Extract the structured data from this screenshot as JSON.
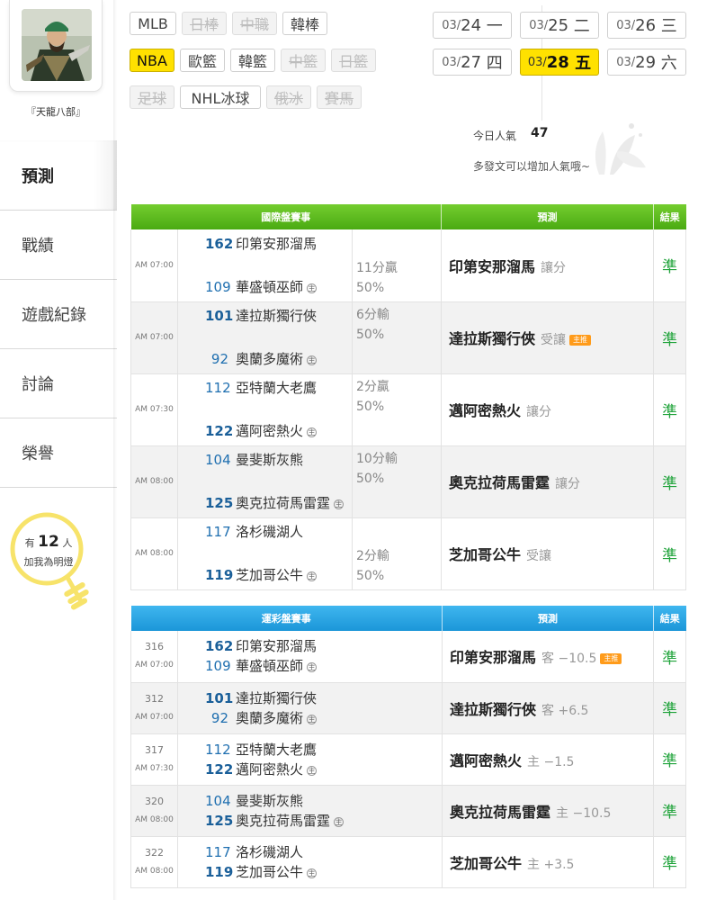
{
  "user": {
    "name": "『天龍八部』"
  },
  "sidebar": {
    "items": [
      {
        "label": "預測",
        "active": true
      },
      {
        "label": "戰績"
      },
      {
        "label": "遊戲紀錄"
      },
      {
        "label": "討論"
      },
      {
        "label": "榮譽"
      }
    ],
    "fans": {
      "prefix": "有",
      "count": "12",
      "suffix": "人",
      "caption": "加我為明燈"
    }
  },
  "leagues": [
    {
      "label": "MLB",
      "state": "normal"
    },
    {
      "label": "日棒",
      "state": "disabled"
    },
    {
      "label": "中職",
      "state": "disabled"
    },
    {
      "label": "韓棒",
      "state": "normal"
    },
    {
      "label": "NBA",
      "state": "selected"
    },
    {
      "label": "歐籃",
      "state": "normal"
    },
    {
      "label": "韓籃",
      "state": "normal"
    },
    {
      "label": "中籃",
      "state": "disabled"
    },
    {
      "label": "日籃",
      "state": "disabled"
    },
    {
      "label": "足球",
      "state": "disabled"
    },
    {
      "label": "NHL冰球",
      "state": "normal"
    },
    {
      "label": "俄冰",
      "state": "disabled"
    },
    {
      "label": "賽馬",
      "state": "disabled"
    }
  ],
  "dates": [
    {
      "mm": "03/",
      "dd": "24",
      "dow": "一"
    },
    {
      "mm": "03/",
      "dd": "25",
      "dow": "二"
    },
    {
      "mm": "03/",
      "dd": "26",
      "dow": "三"
    },
    {
      "mm": "03/",
      "dd": "27",
      "dow": "四"
    },
    {
      "mm": "03/",
      "dd": "28",
      "dow": "五",
      "selected": true
    },
    {
      "mm": "03/",
      "dd": "29",
      "dow": "六"
    }
  ],
  "popularity": {
    "label": "今日人氣",
    "value": "47",
    "hint": "多發文可以增加人氣哦~"
  },
  "intl": {
    "header": {
      "title": "國際盤賽事",
      "pred": "預測",
      "result": "結果"
    },
    "rows": [
      {
        "time": "AM 07:00",
        "away_score": "162",
        "away": "印第安那溜馬",
        "home_score": "109",
        "home": "華盛頓巫師",
        "away_bold": true,
        "home_bold": false,
        "res1": "11分贏",
        "res2": "50%",
        "res_pos": "top",
        "pred": "印第安那溜馬",
        "pred_sub": "讓分",
        "badge": "",
        "ok": "準"
      },
      {
        "time": "AM 07:00",
        "away_score": "101",
        "away": "達拉斯獨行俠",
        "home_score": "92",
        "home": "奧蘭多魔術",
        "away_bold": true,
        "home_bold": false,
        "res1": "6分輸",
        "res2": "50%",
        "res_pos": "bottom",
        "pred": "達拉斯獨行俠",
        "pred_sub": "受讓",
        "badge": "主推",
        "ok": "準"
      },
      {
        "time": "AM 07:30",
        "away_score": "112",
        "away": "亞特蘭大老鷹",
        "home_score": "122",
        "home": "邁阿密熱火",
        "away_bold": false,
        "home_bold": true,
        "res1": "2分贏",
        "res2": "50%",
        "res_pos": "bottom",
        "pred": "邁阿密熱火",
        "pred_sub": "讓分",
        "badge": "",
        "ok": "準"
      },
      {
        "time": "AM 08:00",
        "away_score": "104",
        "away": "曼斐斯灰熊",
        "home_score": "125",
        "home": "奧克拉荷馬雷霆",
        "away_bold": false,
        "home_bold": true,
        "res1": "10分輸",
        "res2": "50%",
        "res_pos": "bottom",
        "pred": "奧克拉荷馬雷霆",
        "pred_sub": "讓分",
        "badge": "",
        "ok": "準"
      },
      {
        "time": "AM 08:00",
        "away_score": "117",
        "away": "洛杉磯湖人",
        "home_score": "119",
        "home": "芝加哥公牛",
        "away_bold": false,
        "home_bold": true,
        "res1": "2分輸",
        "res2": "50%",
        "res_pos": "top",
        "pred": "芝加哥公牛",
        "pred_sub": "受讓",
        "badge": "",
        "ok": "準"
      }
    ]
  },
  "lottery": {
    "header": {
      "title": "運彩盤賽事",
      "pred": "預測",
      "result": "結果"
    },
    "rows": [
      {
        "gid": "316",
        "time": "AM 07:00",
        "away_score": "162",
        "away": "印第安那溜馬",
        "home_score": "109",
        "home": "華盛頓巫師",
        "away_bold": true,
        "home_bold": false,
        "pred": "印第安那溜馬",
        "pred_sub": "客 −10.5",
        "badge": "主推",
        "ok": "準"
      },
      {
        "gid": "312",
        "time": "AM 07:00",
        "away_score": "101",
        "away": "達拉斯獨行俠",
        "home_score": "92",
        "home": "奧蘭多魔術",
        "away_bold": true,
        "home_bold": false,
        "pred": "達拉斯獨行俠",
        "pred_sub": "客 +6.5",
        "badge": "",
        "ok": "準"
      },
      {
        "gid": "317",
        "time": "AM 07:30",
        "away_score": "112",
        "away": "亞特蘭大老鷹",
        "home_score": "122",
        "home": "邁阿密熱火",
        "away_bold": false,
        "home_bold": true,
        "pred": "邁阿密熱火",
        "pred_sub": "主 −1.5",
        "badge": "",
        "ok": "準"
      },
      {
        "gid": "320",
        "time": "AM 08:00",
        "away_score": "104",
        "away": "曼斐斯灰熊",
        "home_score": "125",
        "home": "奧克拉荷馬雷霆",
        "away_bold": false,
        "home_bold": true,
        "pred": "奧克拉荷馬雷霆",
        "pred_sub": "主 −10.5",
        "badge": "",
        "ok": "準"
      },
      {
        "gid": "322",
        "time": "AM 08:00",
        "away_score": "117",
        "away": "洛杉磯湖人",
        "home_score": "119",
        "home": "芝加哥公牛",
        "away_bold": false,
        "home_bold": true,
        "pred": "芝加哥公牛",
        "pred_sub": "主 +3.5",
        "badge": "",
        "ok": "準"
      }
    ]
  },
  "home_marker": "主",
  "colors": {
    "accent_yellow": "#ffe100",
    "green_header": "#5bb81e",
    "blue_header": "#23a0e0",
    "ok_green": "#1fa33a",
    "score_blue": "#1f6fb0",
    "badge_orange": "#ff9b1a"
  }
}
